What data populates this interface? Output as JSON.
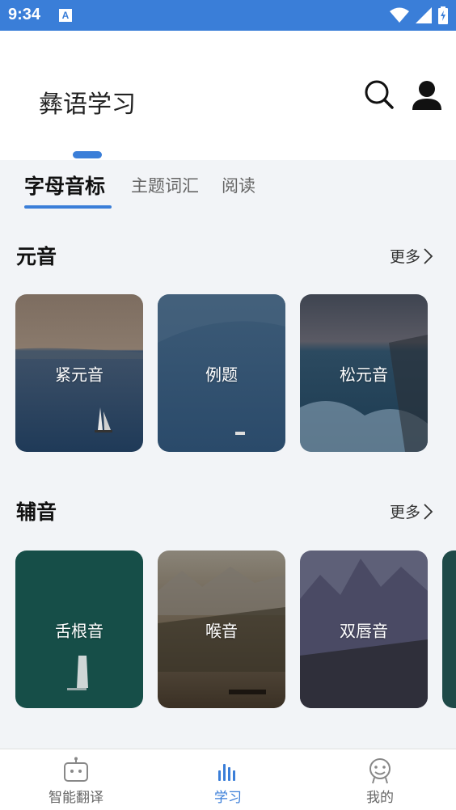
{
  "status_bar": {
    "time": "9:34",
    "app_icon_letter": "A"
  },
  "header": {
    "title": "彝语学习"
  },
  "tabs": [
    {
      "label": "字母音标",
      "active": true
    },
    {
      "label": "主题词汇",
      "active": false
    },
    {
      "label": "阅读",
      "active": false
    }
  ],
  "sections": [
    {
      "title": "元音",
      "more_label": "更多",
      "cards": [
        {
          "label": "紧元音"
        },
        {
          "label": "例题"
        },
        {
          "label": "松元音"
        }
      ]
    },
    {
      "title": "辅音",
      "more_label": "更多",
      "cards": [
        {
          "label": "舌根音"
        },
        {
          "label": "喉音"
        },
        {
          "label": "双唇音"
        }
      ]
    }
  ],
  "bottom_nav": [
    {
      "label": "智能翻译",
      "icon": "robot-icon",
      "active": false
    },
    {
      "label": "学习",
      "icon": "bar-chart-icon",
      "active": true
    },
    {
      "label": "我的",
      "icon": "smiley-face-icon",
      "active": false
    }
  ],
  "colors": {
    "accent": "#3a7ed8",
    "background": "#f2f4f7"
  }
}
